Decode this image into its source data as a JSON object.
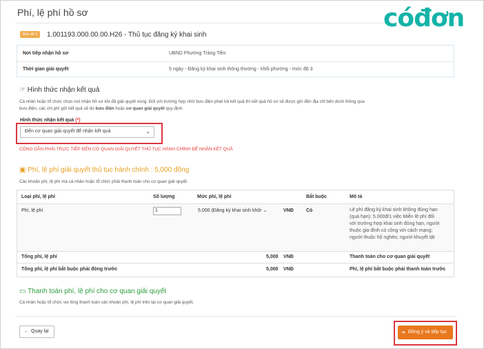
{
  "page": {
    "title": "Phí, lệ phí hồ sơ",
    "logo": "cóđơn"
  },
  "procedure": {
    "level_badge": "Mức độ 3",
    "code_title": "1.001193.000.00.00.H26 - Thủ tục đăng ký khai sinh"
  },
  "info": [
    {
      "label": "Nơi tiếp nhận hồ sơ",
      "value": "UBND Phường Tràng Tiền"
    },
    {
      "label": "Thời gian giải quyết",
      "value": "5 ngày - Đăng ký khai sinh thông thường - khối phường - mức độ 3"
    }
  ],
  "receive": {
    "heading": "Hình thức nhận kết quả",
    "desc1": "Cá nhân hoặc tổ chức chọn nơi nhận hồ sơ khi đã giải quyết xong. Đối với trường hợp nhờ bưu điện phát trả kết quả thì kết quả hồ sơ sẽ được gửi đến địa chỉ bên dưới thông qua",
    "desc2_a": "bưu điện, các chi phí gửi kết quả sẽ do ",
    "desc2_b": "bưu điện",
    "desc2_c": " hoặc ",
    "desc2_d": "cơ quan giải quyết",
    "desc2_e": " quy định.",
    "field_label": "Hình thức nhận kết quả",
    "required_mark": "(*)",
    "selected": "Đến cơ quan giải quyết để nhận kết quả",
    "warning": "CÔNG DÂN PHẢI TRỰC TIẾP ĐẾN CƠ QUAN GIẢI QUYẾT THỦ TỤC HÀNH CHÍNH ĐỂ NHẬN KẾT QUẢ"
  },
  "fees": {
    "heading": "Phí, lệ phí giải quyết thủ tục hành chính : 5,000 đồng",
    "desc": "Các khoản phí, lệ phí mà cá nhân hoặc tổ chức phải thanh toán cho cơ quan giải quyết.",
    "columns": [
      "Loại phí, lệ phí",
      "Số lượng",
      "Mức phí, lệ phí",
      "Bắt buộc",
      "Mô tả"
    ],
    "row": {
      "type": "Phí, lệ phí",
      "qty": "1",
      "rate": "5.000 (Đăng ký khai sinh khôr",
      "currency": "VNĐ",
      "required": "Có",
      "desc": [
        "Lệ phí đăng ký khai sinh không đúng hạn",
        "(quá hạn): 5.000đ/1 việc Miễn lệ phí đối",
        "với trường hợp khai sinh đúng hạn, người",
        "thuộc gia đình có công với cách mạng;",
        "người thuộc hộ nghèo; người khuyết tật"
      ]
    },
    "total": {
      "label": "Tổng phí, lệ phí",
      "amount": "5,000",
      "currency": "VNĐ",
      "note": "Thanh toán cho cơ quan giải quyết"
    },
    "mandatory": {
      "label": "Tổng phí, lệ phí bắt buộc phải đóng trước",
      "amount": "5,000",
      "currency": "VNĐ",
      "note": "Phí, lệ phí bắt buộc phải thanh toán trước"
    }
  },
  "payment": {
    "heading": "Thanh toán phí, lệ phí cho cơ quan giải quyết",
    "desc": "Cá nhân hoặc tổ chức vui lòng thanh toán các khoản phí, lệ phí trên tại cơ quan giải quyết."
  },
  "buttons": {
    "back": "Quay lại",
    "next": "Đồng ý và tiếp tục"
  },
  "colors": {
    "accent_orange": "#e8781d",
    "highlight_red": "#d9363e",
    "logo_teal": "#14b3a8",
    "fee_gold": "#e6a021",
    "pay_green": "#2e9e3f"
  }
}
